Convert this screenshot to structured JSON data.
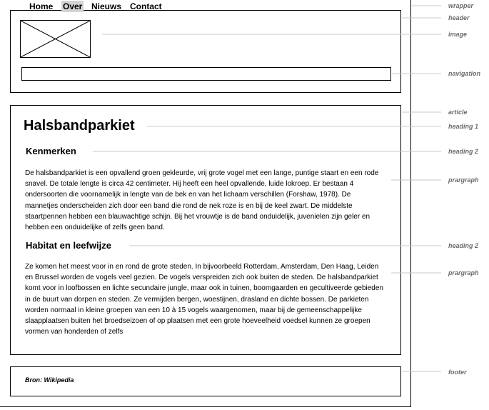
{
  "header": {
    "nav": [
      {
        "label": "Home",
        "active": false
      },
      {
        "label": "Over",
        "active": true
      },
      {
        "label": "Nieuws",
        "active": false
      },
      {
        "label": "Contact",
        "active": false
      }
    ]
  },
  "article": {
    "heading1": "Halsbandparkiet",
    "sections": [
      {
        "heading": "Kenmerken",
        "paragraph": "De halsbandparkiet is een opvallend groen gekleurde, vrij grote vogel met een lange, puntige staart en een rode snavel. De totale lengte is circa 42 centimeter. Hij heeft een heel opvallende, luide lokroep. Er bestaan 4 ondersoorten die voornamelijk in lengte van de bek en van het lichaam verschillen (Forshaw, 1978). De mannetjes onderscheiden zich door een band die rond de nek roze is en bij de keel zwart. De middelste staartpennen hebben een blauwachtige schijn. Bij het vrouwtje is de band onduidelijk, juvenielen zijn geler en hebben een onduidelijke of zelfs geen band."
      },
      {
        "heading": "Habitat en leefwijze",
        "paragraph": "Ze komen het meest voor in en rond de grote steden. In bijvoorbeeld Rotterdam, Amsterdam, Den Haag, Leiden en Brussel worden de vogels veel gezien. De vogels verspreiden zich ook buiten de steden. De halsbandparkiet komt voor in loofbossen en lichte secundaire jungle, maar ook in tuinen, boomgaarden en gecultiveerde gebieden in de buurt van dorpen en steden. Ze vermijden bergen, woestijnen, drasland en dichte bossen. De parkieten worden normaal in kleine groepen van een 10 à 15 vogels waargenomen, maar bij de gemeenschappelijke slaapplaatsen buiten het broedseizoen of op plaatsen met een grote hoeveelheid voedsel kunnen ze groepen vormen van honderden of zelfs"
      }
    ]
  },
  "footer": {
    "source": "Bron: Wikipedia"
  },
  "labels": {
    "wrapper": "wrapper",
    "header": "header",
    "image": "image",
    "navigation": "navigation",
    "article": "article",
    "heading1": "heading 1",
    "heading2a": "heading 2",
    "paragraph1": "prargraph",
    "heading2b": "heading 2",
    "paragraph2": "prargraph",
    "footer": "footer"
  },
  "colors": {
    "leader_line": "#c8c8c8",
    "label_text": "#6b6b6b",
    "nav_active_bg": "#d4d4d4"
  }
}
